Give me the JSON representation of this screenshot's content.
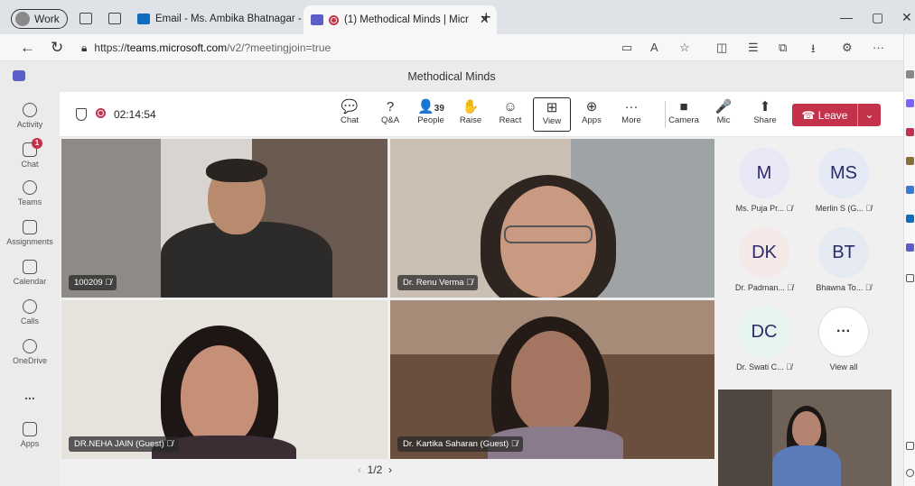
{
  "browser": {
    "profile_label": "Work",
    "tabs": [
      {
        "title": "Email - Ms. Ambika Bhatnagar - O"
      },
      {
        "title": "(1) Methodical Minds | Micr"
      }
    ],
    "new_tab": "+",
    "url_prefix": "https://",
    "url_host": "teams.microsoft.com",
    "url_path": "/v2/?meetingjoin=true"
  },
  "teams": {
    "meeting_title": "Methodical Minds",
    "rail": [
      {
        "label": "Activity",
        "icon": "bell-icon"
      },
      {
        "label": "Chat",
        "icon": "chat-icon",
        "badge": "1"
      },
      {
        "label": "Teams",
        "icon": "teams-icon"
      },
      {
        "label": "Assignments",
        "icon": "assignments-icon"
      },
      {
        "label": "Calendar",
        "icon": "calendar-icon"
      },
      {
        "label": "Calls",
        "icon": "phone-icon"
      },
      {
        "label": "OneDrive",
        "icon": "cloud-icon"
      },
      {
        "label": "...",
        "icon": "more-icon"
      },
      {
        "label": "Apps",
        "icon": "plus-icon"
      }
    ],
    "timer": "02:14:54",
    "toolbar": [
      {
        "label": "Chat",
        "glyph": "💬"
      },
      {
        "label": "Q&A",
        "glyph": "?"
      },
      {
        "label": "People",
        "glyph": "👤",
        "count": "39"
      },
      {
        "label": "Raise",
        "glyph": "✋"
      },
      {
        "label": "React",
        "glyph": "☺"
      },
      {
        "label": "View",
        "glyph": "⊞"
      },
      {
        "label": "Apps",
        "glyph": "⊕"
      },
      {
        "label": "More",
        "glyph": "···"
      },
      {
        "label": "Camera",
        "glyph": "■"
      },
      {
        "label": "Mic",
        "glyph": "🎤"
      },
      {
        "label": "Share",
        "glyph": "⬆"
      }
    ],
    "leave_label": "Leave",
    "video_tiles": [
      {
        "name": "100209"
      },
      {
        "name": "Dr. Renu Verma"
      },
      {
        "name": "DR.NEHA JAIN (Guest)"
      },
      {
        "name": "Dr. Kartika Saharan (Guest)"
      }
    ],
    "pager": {
      "prev": "‹",
      "current": "1/2",
      "next": "›"
    },
    "roster": [
      {
        "initials": "M",
        "name": "Ms. Puja Pr...",
        "color": "#e9e7f5"
      },
      {
        "initials": "MS",
        "name": "Merlin S (G...",
        "color": "#e5e9f5"
      },
      {
        "initials": "DK",
        "name": "Dr. Padman...",
        "color": "#f5e9e7"
      },
      {
        "initials": "BT",
        "name": "Bhawna To...",
        "color": "#e5e9f2"
      },
      {
        "initials": "DC",
        "name": "Dr. Swati C...",
        "color": "#e6f4ef"
      },
      {
        "initials": "···",
        "name": "View all",
        "color": "#ffffff"
      }
    ],
    "mute_glyph": "🎙̸"
  }
}
